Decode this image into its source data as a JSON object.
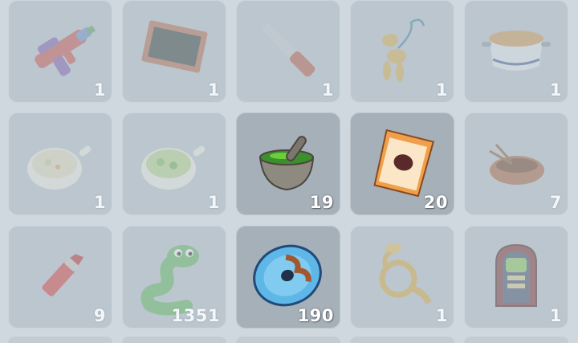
{
  "inventory": {
    "items": [
      {
        "name": "water-gun",
        "count": "1",
        "state": "dim"
      },
      {
        "name": "chalkboard",
        "count": "1",
        "state": "dim"
      },
      {
        "name": "knife",
        "count": "1",
        "state": "dim"
      },
      {
        "name": "balloon-animal",
        "count": "1",
        "state": "dim"
      },
      {
        "name": "soup-pot",
        "count": "1",
        "state": "dim"
      },
      {
        "name": "cream-soup-bowl",
        "count": "1",
        "state": "dim"
      },
      {
        "name": "green-salad-bowl",
        "count": "1",
        "state": "dim"
      },
      {
        "name": "mortar-and-pestle",
        "count": "19",
        "state": "active"
      },
      {
        "name": "seed-packet",
        "count": "20",
        "state": "active"
      },
      {
        "name": "bird-nest",
        "count": "7",
        "state": "dim"
      },
      {
        "name": "lipstick",
        "count": "9",
        "state": "dim"
      },
      {
        "name": "green-snake",
        "count": "1351",
        "state": "dim"
      },
      {
        "name": "blue-disc",
        "count": "190",
        "state": "active"
      },
      {
        "name": "french-horn",
        "count": "1",
        "state": "dim"
      },
      {
        "name": "jukebox",
        "count": "1",
        "state": "dim"
      }
    ]
  }
}
